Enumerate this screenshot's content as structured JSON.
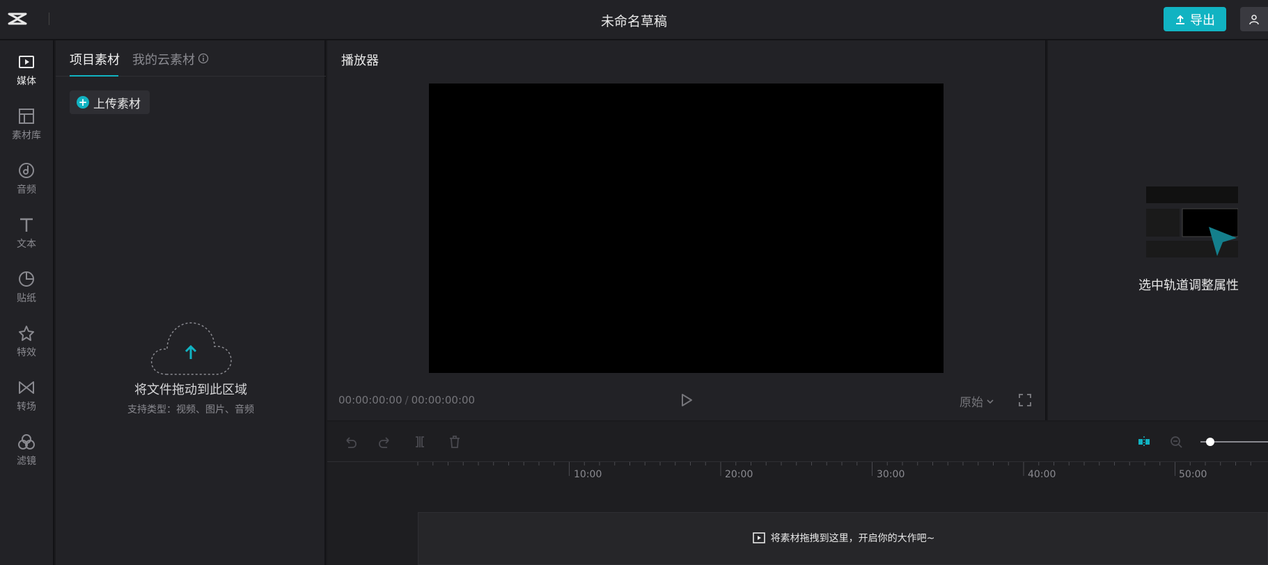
{
  "header": {
    "title": "未命名草稿",
    "export_label": "导出"
  },
  "nav": {
    "items": [
      {
        "label": "媒体",
        "icon": "media-icon"
      },
      {
        "label": "素材库",
        "icon": "library-icon"
      },
      {
        "label": "音频",
        "icon": "audio-icon"
      },
      {
        "label": "文本",
        "icon": "text-icon"
      },
      {
        "label": "贴纸",
        "icon": "sticker-icon"
      },
      {
        "label": "特效",
        "icon": "effects-icon"
      },
      {
        "label": "转场",
        "icon": "transition-icon"
      },
      {
        "label": "滤镜",
        "icon": "filter-icon"
      }
    ]
  },
  "media": {
    "tabs": [
      "项目素材",
      "我的云素材"
    ],
    "upload_label": "上传素材",
    "drop_title": "将文件拖动到此区域",
    "drop_subtitle": "支持类型：视频、图片、音频"
  },
  "player": {
    "title": "播放器",
    "current_time": "00:00:00:00",
    "total_time": "00:00:00:00",
    "ratio_label": "原始"
  },
  "props": {
    "hint": "选中轨道调整属性"
  },
  "timeline": {
    "ticks": [
      "10:00",
      "20:00",
      "30:00",
      "40:00",
      "50:00"
    ],
    "track_hint": "将素材拖拽到这里，开启你的大作吧~"
  },
  "colors": {
    "accent": "#11b3c2",
    "background": "#222226"
  }
}
